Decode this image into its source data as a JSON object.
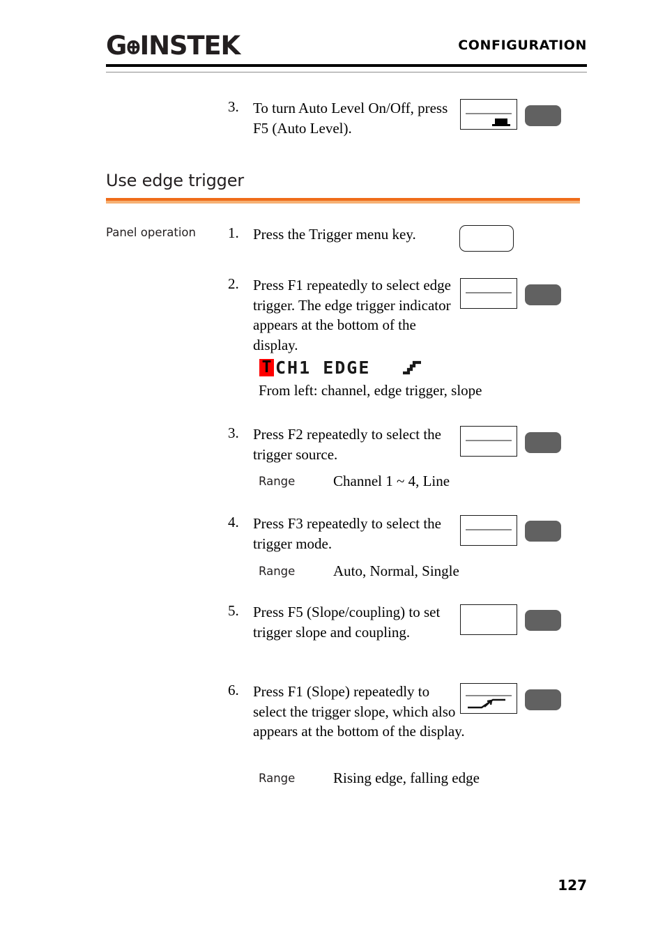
{
  "header": {
    "logo_g": "G",
    "logo_w": "ꚛ",
    "logo_rest": "INSTEK",
    "title": "CONFIGURATION"
  },
  "top_step": {
    "number": "3.",
    "text": "To turn Auto Level On/Off, press F5 (Auto Level).",
    "icon": "screen-with-f5-marker-icon",
    "button": "gray-function-key"
  },
  "section": {
    "heading": "Use edge trigger",
    "side_label": "Panel operation",
    "accent_color": "#ef6c1a",
    "accent_color_light": "#f6b073"
  },
  "steps": [
    {
      "number": "1.",
      "text": "Press the Trigger menu key.",
      "icon": "trigger-menu-key-icon"
    },
    {
      "number": "2.",
      "text": "Press F1 repeatedly to select edge trigger. The edge trigger indicator appears at the bottom of the display.",
      "icon": "screen-with-line-icon",
      "button": "gray-function-key"
    },
    {
      "number": "3.",
      "text": "Press F2 repeatedly to select the trigger source.",
      "icon": "screen-with-line-icon",
      "button": "gray-function-key",
      "range_label": "Range",
      "range_value": "Channel 1 ~ 4, Line"
    },
    {
      "number": "4.",
      "text": "Press F3 repeatedly to select the trigger mode.",
      "icon": "screen-with-line-icon",
      "button": "gray-function-key",
      "range_label": "Range",
      "range_value": "Auto, Normal, Single"
    },
    {
      "number": "5.",
      "text": "Press F5 (Slope/coupling) to set trigger slope and coupling.",
      "icon": "empty-screen-icon",
      "button": "gray-function-key"
    },
    {
      "number": "6.",
      "text": "Press F1 (Slope) repeatedly to select the trigger slope, which also appears at the bottom of the display.",
      "icon": "screen-with-slope-icon",
      "button": "gray-function-key",
      "range_label": "Range",
      "range_value": "Rising edge, falling edge"
    }
  ],
  "lcd_indicator": {
    "trigger_glyph": "T",
    "trigger_bg": "#ff0000",
    "text": "CH1 EDGE",
    "slope_icon": "rising-edge-slope-icon",
    "caption": "From left: channel, edge trigger, slope"
  },
  "footer": {
    "page_number": "127"
  }
}
